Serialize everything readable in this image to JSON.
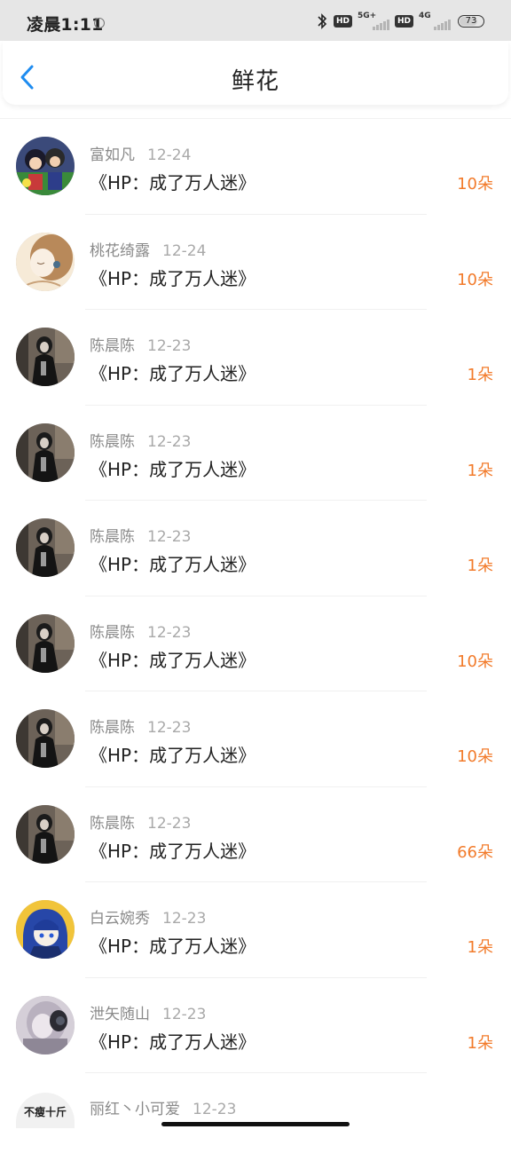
{
  "status_bar": {
    "time": "凌晨1:11",
    "hd1": "HD",
    "network1": "5G+",
    "hd2": "HD",
    "network2": "4G",
    "battery": "73"
  },
  "header": {
    "title": "鲜花"
  },
  "rows": [
    {
      "name": "富如凡",
      "date": "12-24",
      "book": "《HP：成了万人迷》",
      "count": "10朵",
      "avatar": "anime-group"
    },
    {
      "name": "桃花绮露",
      "date": "12-24",
      "book": "《HP：成了万人迷》",
      "count": "10朵",
      "avatar": "sketch-girl"
    },
    {
      "name": "陈晨陈",
      "date": "12-23",
      "book": "《HP：成了万人迷》",
      "count": "1朵",
      "avatar": "dark-figure"
    },
    {
      "name": "陈晨陈",
      "date": "12-23",
      "book": "《HP：成了万人迷》",
      "count": "1朵",
      "avatar": "dark-figure"
    },
    {
      "name": "陈晨陈",
      "date": "12-23",
      "book": "《HP：成了万人迷》",
      "count": "1朵",
      "avatar": "dark-figure"
    },
    {
      "name": "陈晨陈",
      "date": "12-23",
      "book": "《HP：成了万人迷》",
      "count": "10朵",
      "avatar": "dark-figure"
    },
    {
      "name": "陈晨陈",
      "date": "12-23",
      "book": "《HP：成了万人迷》",
      "count": "10朵",
      "avatar": "dark-figure"
    },
    {
      "name": "陈晨陈",
      "date": "12-23",
      "book": "《HP：成了万人迷》",
      "count": "66朵",
      "avatar": "dark-figure"
    },
    {
      "name": "白云婉秀",
      "date": "12-23",
      "book": "《HP：成了万人迷》",
      "count": "1朵",
      "avatar": "blue-anime"
    },
    {
      "name": "泄矢随山",
      "date": "12-23",
      "book": "《HP：成了万人迷》",
      "count": "1朵",
      "avatar": "blurry-photo"
    }
  ],
  "partial_row": {
    "avatar_text": "不瘦十斤",
    "name": "丽红丶小可爱",
    "date": "12-23"
  },
  "colors": {
    "accent_blue": "#1e8cf0",
    "flower_orange": "#f27b2b"
  }
}
